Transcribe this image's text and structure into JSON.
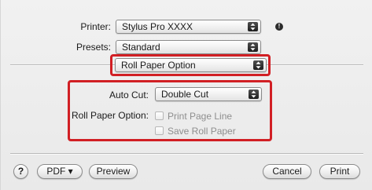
{
  "printer": {
    "label": "Printer:",
    "value": "Stylus Pro XXXX"
  },
  "presets": {
    "label": "Presets:",
    "value": "Standard"
  },
  "section": {
    "value": "Roll Paper Option"
  },
  "auto_cut": {
    "label": "Auto Cut:",
    "value": "Double Cut"
  },
  "roll_paper_option": {
    "label": "Roll Paper Option:",
    "print_page_line": "Print Page Line",
    "save_roll_paper": "Save Roll Paper"
  },
  "footer": {
    "help": "?",
    "pdf": "PDF ▾",
    "preview": "Preview",
    "cancel": "Cancel",
    "print": "Print"
  },
  "colors": {
    "highlight_box": "#d11f24"
  },
  "icons": {
    "info": "info-icon",
    "popup_stepper": "up-down-arrows-icon"
  }
}
